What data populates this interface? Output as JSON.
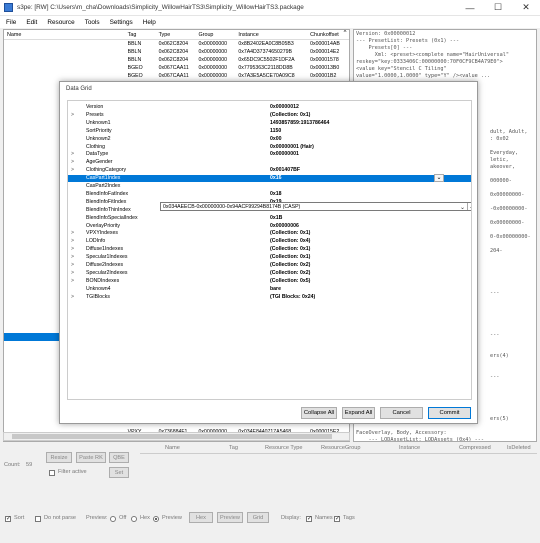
{
  "window": {
    "title": "s3pe: [RW] C:\\Users\\m_cha\\Downloads\\Simplicity_WillowHairTS3\\Simplicity_WillowHairTS3.package",
    "minimize": "—",
    "maximize": "☐",
    "close": "✕"
  },
  "menu": [
    "File",
    "Edit",
    "Resource",
    "Tools",
    "Settings",
    "Help"
  ],
  "list": {
    "headers": [
      "Name",
      "Tag",
      "Type",
      "Group",
      "Instance",
      "Chunkoffset"
    ],
    "rows": [
      [
        "",
        "BBLN",
        "0x062C8204",
        "0x00000000",
        "0x8B2402EA0C8B05B3",
        "0x000014AB"
      ],
      [
        "",
        "BBLN",
        "0x062C8204",
        "0x00000000",
        "0x7A4D37374650279B",
        "0x000014E2"
      ],
      [
        "",
        "BBLN",
        "0x062C8204",
        "0x00000000",
        "0x65DC9C5502F1DF2A",
        "0x00001578"
      ],
      [
        "",
        "BGEO",
        "0x067CAA11",
        "0x00000000",
        "0x7795363C2118DD8B",
        "0x000013B0"
      ],
      [
        "",
        "BGEO",
        "0x067CAA11",
        "0x00000000",
        "0x7A3E5A5CE70A09C8",
        "0x00001B2"
      ]
    ],
    "bottom_row": [
      "",
      "VPXY",
      "0x736884F1",
      "0x00000000",
      "0x034E8440717A5468",
      "0x000015E2"
    ]
  },
  "text_panel": [
    "Version: 0x00000012",
    "--- PresetList: Presets (0x1) ---",
    "    Presets[0] ---",
    "      Xml: <preset><complete name=\"HairUniversal\"",
    "reskey=\"key:0333406C:00000000:70F0CF9CB4A79E0\">",
    "<value key=\"Stencil C Tiling\"",
    "value=\"1.0000,1.0000\" type=\"Y\" /><value ...",
    "dult, Adult,",
    ": 0x02",
    "Everyday,",
    "letic,",
    "akeover,",
    "000000-",
    "0x00000000-",
    "-0x00000000-",
    "0x00000000-",
    "0-0x00000000-",
    "204-",
    "---",
    "---",
    "ers(4)",
    "---",
    "ers(5)",
    "alp,",
    "FaceOverlay, Body, Accessory:",
    "    --- LODAssetList: LODAssets (0x4) ---",
    "    --- LODAssets[0] ---"
  ],
  "bottom": {
    "count_label": "Count:",
    "count_value": "59",
    "resize_label": "Resize",
    "paste_rk_label": "Paste RK",
    "qbe_label": "QBE",
    "filter_active_label": "Filter active",
    "set_label": "Set",
    "filter_headers": [
      "Name",
      "Tag",
      "Resource Type",
      "ResourceGroup",
      "Instance",
      "Compressed",
      "IsDeleted"
    ],
    "sort_label": "Sort",
    "do_not_parse_label": "Do not parse",
    "preview_label": "Preview:",
    "off_label": "Off",
    "hex_label": "Hex",
    "preview_opt_label": "Preview",
    "hex_btn_label": "Hex",
    "preview_btn_label": "Preview",
    "grid_btn_label": "Grid",
    "display_label": "Display:",
    "names_label": "Names",
    "tags_label": "Tags"
  },
  "dialog": {
    "title": "Data Grid",
    "rows": [
      {
        "expand": "",
        "name": "Version",
        "value": "0x00000012"
      },
      {
        "expand": ">",
        "name": "Presets",
        "value": "(Collection: 0x1)"
      },
      {
        "expand": "",
        "name": "Unknown1",
        "value": "1493857859:1913786464"
      },
      {
        "expand": "",
        "name": "SortPriority",
        "value": "1150"
      },
      {
        "expand": "",
        "name": "Unknown2",
        "value": "0x00"
      },
      {
        "expand": "",
        "name": "Clothing",
        "value": "0x00000001 (Hair)"
      },
      {
        "expand": ">",
        "name": "DataType",
        "value": "0x00000001"
      },
      {
        "expand": ">",
        "name": "AgeGender",
        "value": ""
      },
      {
        "expand": ">",
        "name": "ClothingCategory",
        "value": "0x001407BF"
      },
      {
        "expand": "",
        "name": "CasPart1Index",
        "value": "0x16"
      },
      {
        "expand": "",
        "name": "CasPart2Index",
        "value": ""
      },
      {
        "expand": "",
        "name": "BlendInfoFatIndex",
        "value": "0x18"
      },
      {
        "expand": "",
        "name": "BlendInfoFitIndex",
        "value": "0x19"
      },
      {
        "expand": "",
        "name": "BlendInfoThinIndex",
        "value": "0x1A"
      },
      {
        "expand": "",
        "name": "BlendInfoSpecialIndex",
        "value": "0x1B"
      },
      {
        "expand": "",
        "name": "OverlayPriority",
        "value": "0x00000006"
      },
      {
        "expand": ">",
        "name": "VPXYIndexes",
        "value": "(Collection: 0x1)"
      },
      {
        "expand": ">",
        "name": "LODInfo",
        "value": "(Collection: 0x4)"
      },
      {
        "expand": ">",
        "name": "Diffuse1Indexes",
        "value": "(Collection: 0x1)"
      },
      {
        "expand": ">",
        "name": "Specular1Indexes",
        "value": "(Collection: 0x1)"
      },
      {
        "expand": ">",
        "name": "Diffuse2Indexes",
        "value": "(Collection: 0x2)"
      },
      {
        "expand": ">",
        "name": "Specular2Indexes",
        "value": "(Collection: 0x2)"
      },
      {
        "expand": ">",
        "name": "BONDIndexes",
        "value": "(Collection: 0x5)"
      },
      {
        "expand": "",
        "name": "Unknown4",
        "value": "bare"
      },
      {
        "expand": ">",
        "name": "TGIBlocks",
        "value": "(TGI Blocks: 0x24)"
      }
    ],
    "dropdown_value": "0x034AEECB-0x00000000-0x94ACF99294B8174B (CASP)",
    "buttons": {
      "collapse_all": "Collapse All",
      "expand_all": "Expand All",
      "cancel": "Cancel",
      "commit": "Commit"
    }
  },
  "colors": {
    "selection": "#0078d7"
  }
}
